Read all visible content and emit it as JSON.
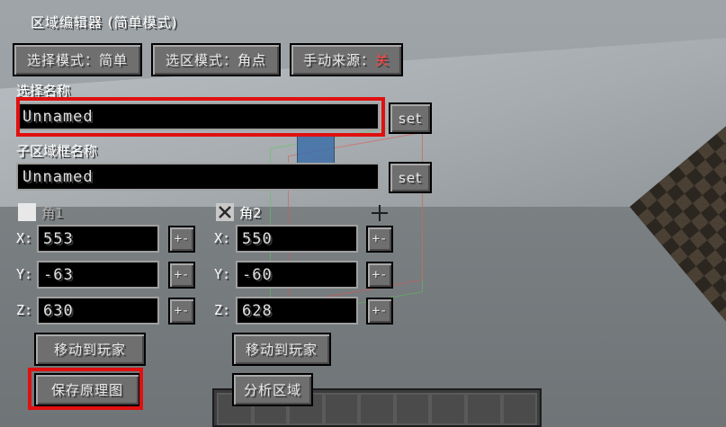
{
  "title": "区域编辑器 (简单模式)",
  "top_buttons": {
    "selection_mode": "选择模式：简单",
    "corner_mode": "选区模式：角点",
    "manual_source_label": "手动来源：",
    "manual_source_value": "关"
  },
  "selection_name": {
    "label": "选择名称",
    "value": "Unnamed",
    "set_label": "set"
  },
  "subregion_name": {
    "label": "子区域框名称",
    "value": "Unnamed",
    "set_label": "set"
  },
  "corner1": {
    "label": "角1",
    "checked": false,
    "x": "553",
    "y": "-63",
    "z": "630",
    "move_label": "移动到玩家"
  },
  "corner2": {
    "label": "角2",
    "checked": true,
    "x": "550",
    "y": "-60",
    "z": "628",
    "move_label": "移动到玩家"
  },
  "axes": {
    "x": "X:",
    "y": "Y:",
    "z": "Z:"
  },
  "stepper_label": "+-",
  "bottom_buttons": {
    "save_schematic": "保存原理图",
    "analyze_area": "分析区域"
  },
  "colors": {
    "highlight": "#e01010",
    "off_value": "#ff4040"
  }
}
